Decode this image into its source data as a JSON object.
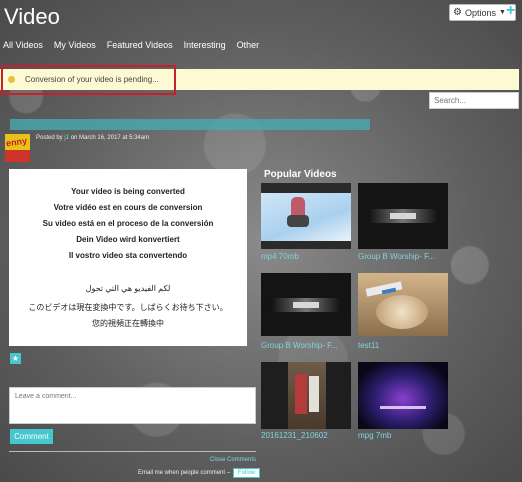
{
  "header": {
    "title": "Video",
    "options_label": "Options",
    "add_icon": "plus-icon",
    "options_icon": "gear-icon"
  },
  "nav": {
    "tabs": [
      {
        "label": "All Videos"
      },
      {
        "label": "My Videos"
      },
      {
        "label": "Featured Videos"
      },
      {
        "label": "Interesting"
      },
      {
        "label": "Other"
      }
    ]
  },
  "notice": {
    "text": "Conversion of your video is pending..."
  },
  "search": {
    "placeholder": "Search..."
  },
  "post": {
    "posted_prefix": "Posted by",
    "author": "j1",
    "date": "on March 16, 2017 at 5:34am",
    "avatar_text": "enny"
  },
  "converting": {
    "lines": [
      "Your video is being converted",
      "Votre vidéo est en cours de conversion",
      "Su video está en el proceso de la conversión",
      "Dein Video wird konvertiert",
      "Il vostro video sta convertendo",
      "لكم الفيديو هي التي تحول",
      "このビデオは現在変換中です。しばらくお待ち下さい。",
      "您的視頻正在轉換中"
    ]
  },
  "comments": {
    "placeholder": "Leave a comment...",
    "button": "Comment",
    "close_link": "Close Comments",
    "email_label": "Email me when people comment –",
    "follow": "Follow"
  },
  "popular": {
    "title": "Popular Videos",
    "videos": [
      {
        "label": "mp4 70mb"
      },
      {
        "label": "Group B Worship- F..."
      },
      {
        "label": "Group B Worship- F..."
      },
      {
        "label": "test11"
      },
      {
        "label": "20161231_210602"
      },
      {
        "label": "mpg 7mb"
      }
    ]
  },
  "colors": {
    "accent": "#46c6cf",
    "notice_bg": "#fdf9d3",
    "highlight_outline": "#c8202a"
  }
}
